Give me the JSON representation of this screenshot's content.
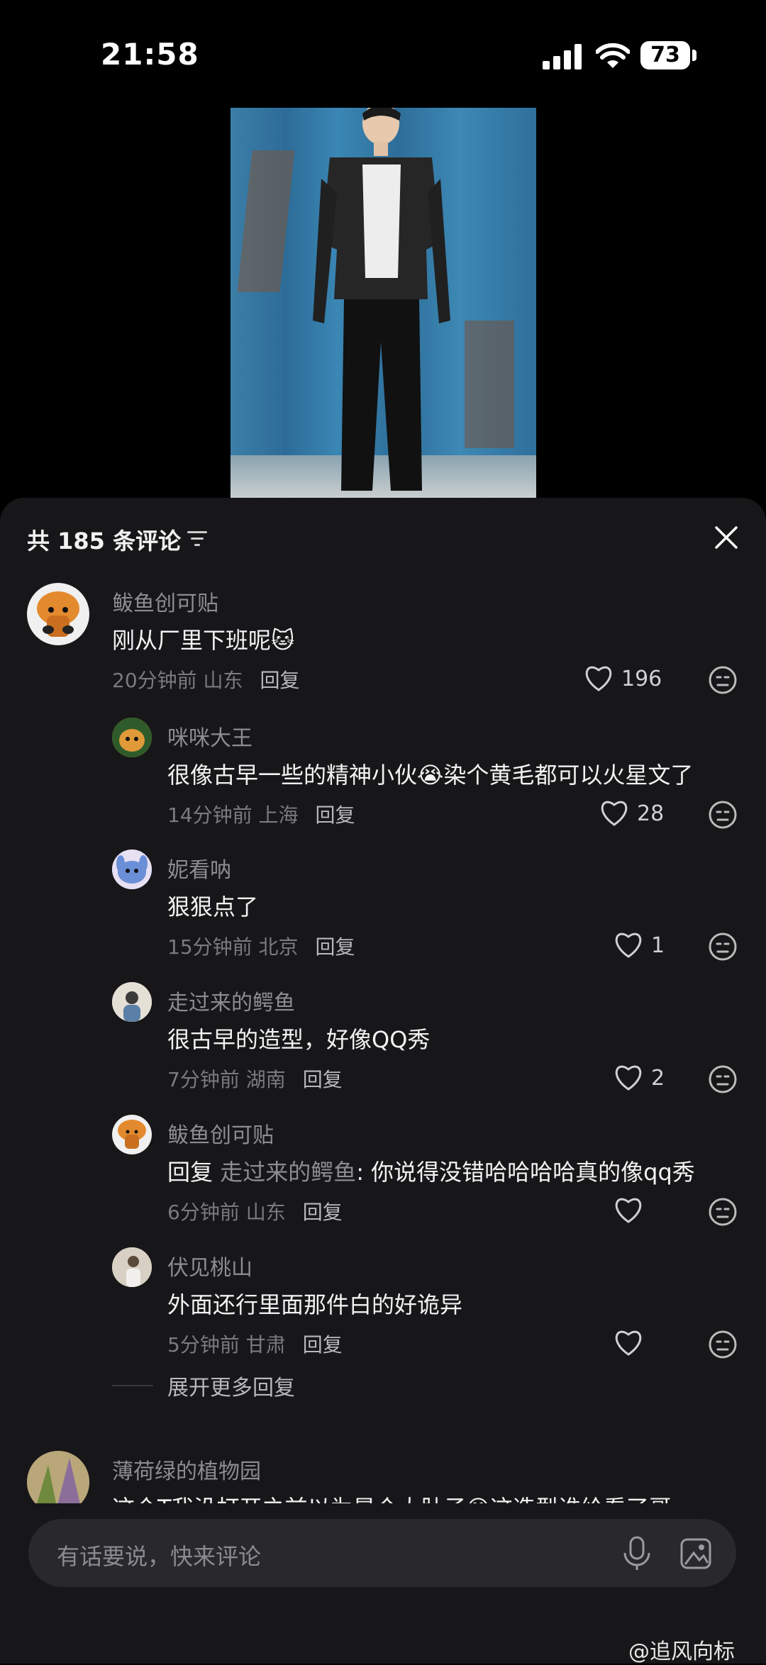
{
  "status_bar": {
    "time": "21:58",
    "battery": "73"
  },
  "comments_header": {
    "count_label": "共 185 条评论"
  },
  "comments": [
    {
      "user": "鲅鱼创可贴",
      "text": "刚从厂里下班呢🐱",
      "meta": "20分钟前 山东",
      "reply_label": "回复",
      "likes": "196",
      "level": "top"
    },
    {
      "user": "咪咪大王",
      "text": "很像古早一些的精神小伙😭染个黄毛都可以火星文了",
      "meta": "14分钟前 上海",
      "reply_label": "回复",
      "likes": "28",
      "level": "reply"
    },
    {
      "user": "妮看呐",
      "text": "狠狠点了",
      "meta": "15分钟前 北京",
      "reply_label": "回复",
      "likes": "1",
      "level": "reply"
    },
    {
      "user": "走过来的鳄鱼",
      "text": "很古早的造型，好像QQ秀",
      "meta": "7分钟前 湖南",
      "reply_label": "回复",
      "likes": "2",
      "level": "reply"
    },
    {
      "user": "鲅鱼创可贴",
      "reply_prefix": "回复 ",
      "reply_to": "走过来的鳄鱼",
      "text": ": 你说得没错哈哈哈哈真的像qq秀",
      "meta": "6分钟前 山东",
      "reply_label": "回复",
      "likes": "",
      "level": "reply"
    },
    {
      "user": "伏见桃山",
      "text": "外面还行里面那件白的好诡异",
      "meta": "5分钟前 甘肃",
      "reply_label": "回复",
      "likes": "",
      "level": "reply"
    },
    {
      "user": "薄荷绿的植物园",
      "text": "这个T我没打开之前以为是个大肚子😅这造型谁给看了哥",
      "level": "top"
    }
  ],
  "expand_more": "展开更多回复",
  "input": {
    "placeholder": "有话要说，快来评论"
  },
  "watermark": "@追风向标"
}
